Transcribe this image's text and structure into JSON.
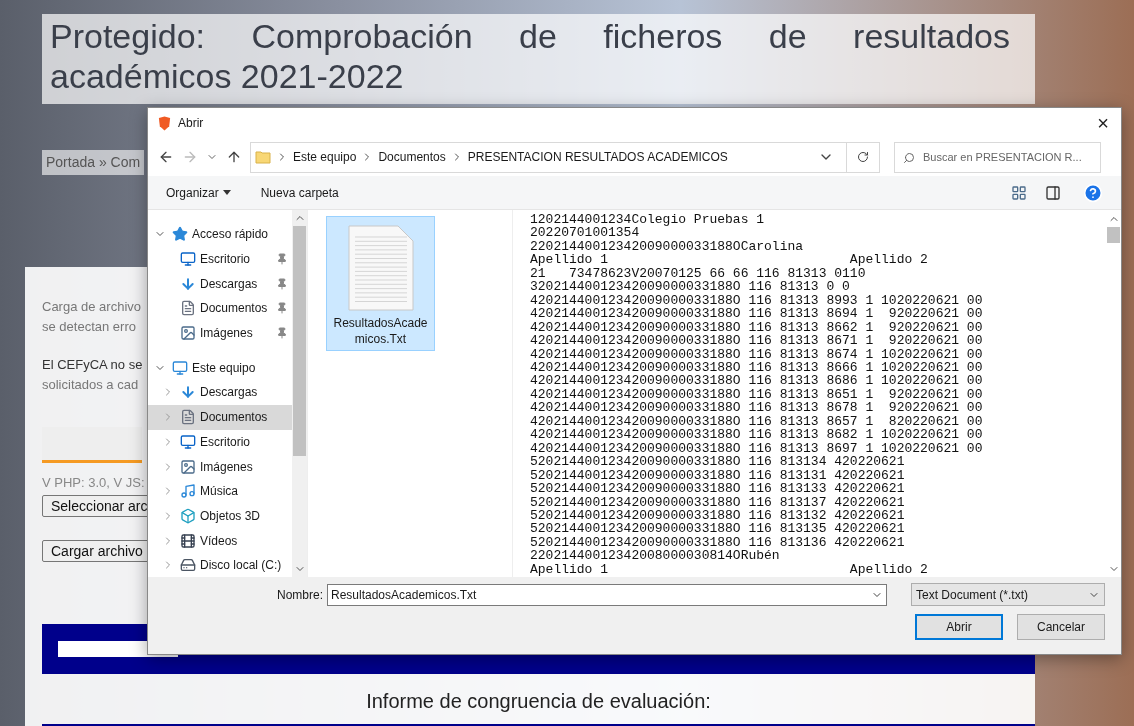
{
  "page": {
    "title": "Protegido: Comprobación de ficheros de resultados académicos 2021-2022",
    "breadcrumb": "Portada » Com",
    "paragraphs": [
      [
        "Carga de archivo",
        "se detectan erro"
      ],
      [
        "El CEFyCA no se",
        "solicitados a cad"
      ]
    ],
    "version": "V PHP: 3.0, V JS:",
    "select_button": "Seleccionar arc",
    "upload_button": "Cargar archivo",
    "report_title": "Informe de congruencia de evaluación:"
  },
  "dialog": {
    "title": "Abrir",
    "close": "×",
    "path": [
      "Este equipo",
      "Documentos",
      "PRESENTACION RESULTADOS ACADEMICOS"
    ],
    "search": {
      "placeholder": "Buscar en PRESENTACION R..."
    },
    "toolbar": {
      "organize": "Organizar",
      "new_folder": "Nueva carpeta"
    },
    "tree": [
      {
        "label": "Acceso rápido",
        "kind": "star",
        "expanded": true,
        "selected": false,
        "children": [
          {
            "label": "Escritorio",
            "kind": "desktop",
            "pinned": true,
            "selected": false
          },
          {
            "label": "Descargas",
            "kind": "downloads",
            "pinned": true,
            "selected": false
          },
          {
            "label": "Documentos",
            "kind": "documents",
            "pinned": true,
            "selected": false
          },
          {
            "label": "Imágenes",
            "kind": "pictures",
            "pinned": true,
            "selected": false
          }
        ]
      },
      {
        "label": "Este equipo",
        "kind": "pc",
        "expanded": true,
        "selected": false,
        "children": [
          {
            "label": "Descargas",
            "kind": "downloads",
            "expanded": false,
            "selected": false
          },
          {
            "label": "Documentos",
            "kind": "documents",
            "expanded": false,
            "selected": true
          },
          {
            "label": "Escritorio",
            "kind": "desktop",
            "expanded": false,
            "selected": false
          },
          {
            "label": "Imágenes",
            "kind": "pictures",
            "expanded": false,
            "selected": false
          },
          {
            "label": "Música",
            "kind": "music",
            "expanded": false,
            "selected": false
          },
          {
            "label": "Objetos 3D",
            "kind": "objects3d",
            "expanded": false,
            "selected": false
          },
          {
            "label": "Vídeos",
            "kind": "videos",
            "expanded": false,
            "selected": false
          },
          {
            "label": "Disco local (C:)",
            "kind": "drive",
            "expanded": false,
            "selected": false
          }
        ]
      }
    ],
    "files": [
      {
        "name": "ResultadosAcademicos.Txt",
        "selected": true
      }
    ],
    "preview_lines": [
      "1202144001234Colegio Pruebas 1",
      "20220701001354",
      "22021440012342009000033188OCarolina",
      "Apellido 1                               Apellido 2",
      "21   73478623V20070125 66 66 116 81313 0110",
      "32021440012342009000033188O 116 81313 0 0",
      "42021440012342009000033188O 116 81313 8993 1 1020220621 00",
      "42021440012342009000033188O 116 81313 8694 1  920220621 00",
      "42021440012342009000033188O 116 81313 8662 1  920220621 00",
      "42021440012342009000033188O 116 81313 8671 1  920220621 00",
      "42021440012342009000033188O 116 81313 8674 1 1020220621 00",
      "42021440012342009000033188O 116 81313 8666 1 1020220621 00",
      "42021440012342009000033188O 116 81313 8686 1 1020220621 00",
      "42021440012342009000033188O 116 81313 8651 1  920220621 00",
      "42021440012342009000033188O 116 81313 8678 1  920220621 00",
      "42021440012342009000033188O 116 81313 8657 1  820220621 00",
      "42021440012342009000033188O 116 81313 8682 1 1020220621 00",
      "42021440012342009000033188O 116 81313 8697 1 1020220621 00",
      "52021440012342009000033188O 116 813134 420220621",
      "52021440012342009000033188O 116 813131 420220621",
      "52021440012342009000033188O 116 813133 420220621",
      "52021440012342009000033188O 116 813137 420220621",
      "52021440012342009000033188O 116 813132 420220621",
      "52021440012342009000033188O 116 813135 420220621",
      "52021440012342009000033188O 116 813136 420220621",
      "22021440012342008000030814ORubén",
      "Apellido 1                               Apellido 2"
    ],
    "name_label": "Nombre:",
    "filename": "ResultadosAcademicos.Txt",
    "filter": "Text Document (*.txt)",
    "open_button": "Abrir",
    "cancel_button": "Cancelar"
  }
}
